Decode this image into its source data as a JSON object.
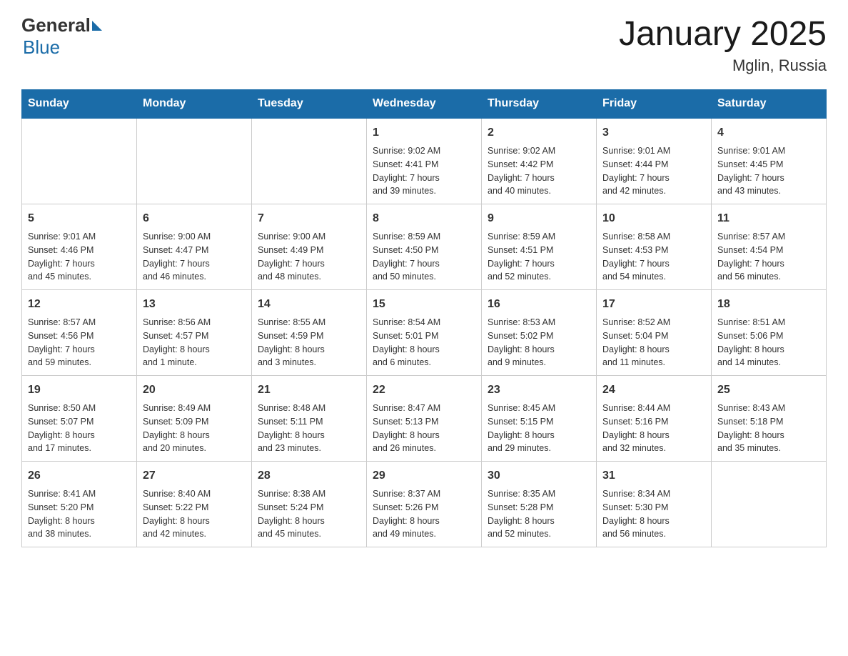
{
  "header": {
    "title": "January 2025",
    "subtitle": "Mglin, Russia",
    "logo_general": "General",
    "logo_blue": "Blue"
  },
  "days_of_week": [
    "Sunday",
    "Monday",
    "Tuesday",
    "Wednesday",
    "Thursday",
    "Friday",
    "Saturday"
  ],
  "weeks": [
    [
      {
        "day": "",
        "info": ""
      },
      {
        "day": "",
        "info": ""
      },
      {
        "day": "",
        "info": ""
      },
      {
        "day": "1",
        "info": "Sunrise: 9:02 AM\nSunset: 4:41 PM\nDaylight: 7 hours\nand 39 minutes."
      },
      {
        "day": "2",
        "info": "Sunrise: 9:02 AM\nSunset: 4:42 PM\nDaylight: 7 hours\nand 40 minutes."
      },
      {
        "day": "3",
        "info": "Sunrise: 9:01 AM\nSunset: 4:44 PM\nDaylight: 7 hours\nand 42 minutes."
      },
      {
        "day": "4",
        "info": "Sunrise: 9:01 AM\nSunset: 4:45 PM\nDaylight: 7 hours\nand 43 minutes."
      }
    ],
    [
      {
        "day": "5",
        "info": "Sunrise: 9:01 AM\nSunset: 4:46 PM\nDaylight: 7 hours\nand 45 minutes."
      },
      {
        "day": "6",
        "info": "Sunrise: 9:00 AM\nSunset: 4:47 PM\nDaylight: 7 hours\nand 46 minutes."
      },
      {
        "day": "7",
        "info": "Sunrise: 9:00 AM\nSunset: 4:49 PM\nDaylight: 7 hours\nand 48 minutes."
      },
      {
        "day": "8",
        "info": "Sunrise: 8:59 AM\nSunset: 4:50 PM\nDaylight: 7 hours\nand 50 minutes."
      },
      {
        "day": "9",
        "info": "Sunrise: 8:59 AM\nSunset: 4:51 PM\nDaylight: 7 hours\nand 52 minutes."
      },
      {
        "day": "10",
        "info": "Sunrise: 8:58 AM\nSunset: 4:53 PM\nDaylight: 7 hours\nand 54 minutes."
      },
      {
        "day": "11",
        "info": "Sunrise: 8:57 AM\nSunset: 4:54 PM\nDaylight: 7 hours\nand 56 minutes."
      }
    ],
    [
      {
        "day": "12",
        "info": "Sunrise: 8:57 AM\nSunset: 4:56 PM\nDaylight: 7 hours\nand 59 minutes."
      },
      {
        "day": "13",
        "info": "Sunrise: 8:56 AM\nSunset: 4:57 PM\nDaylight: 8 hours\nand 1 minute."
      },
      {
        "day": "14",
        "info": "Sunrise: 8:55 AM\nSunset: 4:59 PM\nDaylight: 8 hours\nand 3 minutes."
      },
      {
        "day": "15",
        "info": "Sunrise: 8:54 AM\nSunset: 5:01 PM\nDaylight: 8 hours\nand 6 minutes."
      },
      {
        "day": "16",
        "info": "Sunrise: 8:53 AM\nSunset: 5:02 PM\nDaylight: 8 hours\nand 9 minutes."
      },
      {
        "day": "17",
        "info": "Sunrise: 8:52 AM\nSunset: 5:04 PM\nDaylight: 8 hours\nand 11 minutes."
      },
      {
        "day": "18",
        "info": "Sunrise: 8:51 AM\nSunset: 5:06 PM\nDaylight: 8 hours\nand 14 minutes."
      }
    ],
    [
      {
        "day": "19",
        "info": "Sunrise: 8:50 AM\nSunset: 5:07 PM\nDaylight: 8 hours\nand 17 minutes."
      },
      {
        "day": "20",
        "info": "Sunrise: 8:49 AM\nSunset: 5:09 PM\nDaylight: 8 hours\nand 20 minutes."
      },
      {
        "day": "21",
        "info": "Sunrise: 8:48 AM\nSunset: 5:11 PM\nDaylight: 8 hours\nand 23 minutes."
      },
      {
        "day": "22",
        "info": "Sunrise: 8:47 AM\nSunset: 5:13 PM\nDaylight: 8 hours\nand 26 minutes."
      },
      {
        "day": "23",
        "info": "Sunrise: 8:45 AM\nSunset: 5:15 PM\nDaylight: 8 hours\nand 29 minutes."
      },
      {
        "day": "24",
        "info": "Sunrise: 8:44 AM\nSunset: 5:16 PM\nDaylight: 8 hours\nand 32 minutes."
      },
      {
        "day": "25",
        "info": "Sunrise: 8:43 AM\nSunset: 5:18 PM\nDaylight: 8 hours\nand 35 minutes."
      }
    ],
    [
      {
        "day": "26",
        "info": "Sunrise: 8:41 AM\nSunset: 5:20 PM\nDaylight: 8 hours\nand 38 minutes."
      },
      {
        "day": "27",
        "info": "Sunrise: 8:40 AM\nSunset: 5:22 PM\nDaylight: 8 hours\nand 42 minutes."
      },
      {
        "day": "28",
        "info": "Sunrise: 8:38 AM\nSunset: 5:24 PM\nDaylight: 8 hours\nand 45 minutes."
      },
      {
        "day": "29",
        "info": "Sunrise: 8:37 AM\nSunset: 5:26 PM\nDaylight: 8 hours\nand 49 minutes."
      },
      {
        "day": "30",
        "info": "Sunrise: 8:35 AM\nSunset: 5:28 PM\nDaylight: 8 hours\nand 52 minutes."
      },
      {
        "day": "31",
        "info": "Sunrise: 8:34 AM\nSunset: 5:30 PM\nDaylight: 8 hours\nand 56 minutes."
      },
      {
        "day": "",
        "info": ""
      }
    ]
  ]
}
